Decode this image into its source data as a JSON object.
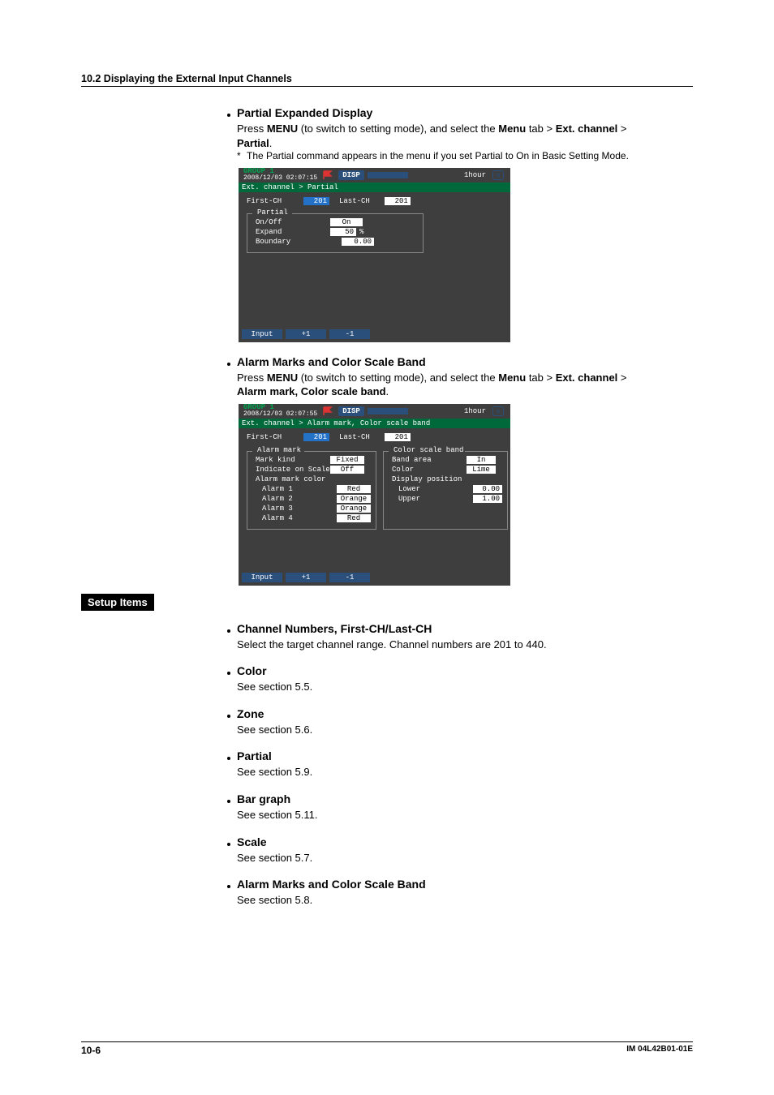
{
  "header": {
    "section": "10.2  Displaying the External Input Channels"
  },
  "partial_section": {
    "title": "Partial Expanded Display",
    "line1_pre": "Press ",
    "menu": "MENU",
    "line1_mid": " (to switch to setting mode), and select the ",
    "menu_tab": "Menu",
    "line1_mid2": " tab > ",
    "ext_channel": "Ext. channel",
    "line1_end": " >",
    "partial_bold": "Partial",
    "period": ".",
    "note": "The Partial command appears in the menu if you set Partial to On in Basic Setting Mode."
  },
  "screenshot1": {
    "group": "GROUP 1",
    "ts": "2008/12/03 02:07:15",
    "disp": "DISP",
    "time": "1hour",
    "breadcrumb": "Ext. channel > Partial",
    "first_ch": "First-CH",
    "first_ch_val": "201",
    "last_ch": "Last-CH",
    "last_ch_val": "201",
    "fs_title": "Partial",
    "row1_lbl": "On/Off",
    "row1_val": "On",
    "row2_lbl": "Expand",
    "row2_val": "50",
    "row2_unit": "%",
    "row3_lbl": "Boundary",
    "row3_val": "0.00",
    "btn_input": "Input",
    "btn_plus": "+1",
    "btn_minus": "-1"
  },
  "alarm_section": {
    "title": "Alarm Marks and Color Scale Band",
    "line1_pre": "Press ",
    "menu": "MENU",
    "line1_mid": " (to switch to setting mode), and select the ",
    "menu_tab": "Menu",
    "line1_mid2": " tab > ",
    "ext_channel": "Ext. channel",
    "line1_end": " >",
    "line2_bold": "Alarm mark, Color scale band",
    "period": "."
  },
  "screenshot2": {
    "group": "GROUP 1",
    "ts": "2008/12/03 02:07:55",
    "disp": "DISP",
    "time": "1hour",
    "breadcrumb": "Ext. channel > Alarm mark, Color scale band",
    "first_ch": "First-CH",
    "first_ch_val": "201",
    "last_ch": "Last-CH",
    "last_ch_val": "201",
    "fs1_title": "Alarm mark",
    "fs1": {
      "r1_lbl": "Mark kind",
      "r1_val": "Fixed",
      "r2_lbl": "Indicate on Scale",
      "r2_val": "Off",
      "r3_lbl": "Alarm mark color",
      "r4_lbl": "Alarm 1",
      "r4_val": "Red",
      "r5_lbl": "Alarm 2",
      "r5_val": "Orange",
      "r6_lbl": "Alarm 3",
      "r6_val": "Orange",
      "r7_lbl": "Alarm 4",
      "r7_val": "Red"
    },
    "fs2_title": "Color scale band",
    "fs2": {
      "r1_lbl": "Band area",
      "r1_val": "In",
      "r2_lbl": "Color",
      "r2_val": "Lime",
      "r3_lbl": "Display position",
      "r4_lbl": "Lower",
      "r4_val": "0.00",
      "r5_lbl": "Upper",
      "r5_val": "1.00"
    },
    "btn_input": "Input",
    "btn_plus": "+1",
    "btn_minus": "-1"
  },
  "setup_items_label": "Setup Items",
  "setup": {
    "s1_title": "Channel Numbers, First-CH/Last-CH",
    "s1_body": "Select the target channel range. Channel numbers are 201 to 440.",
    "s2_title": "Color",
    "s2_body": "See section 5.5.",
    "s3_title": "Zone",
    "s3_body": "See section 5.6.",
    "s4_title": "Partial",
    "s4_body": "See section 5.9.",
    "s5_title": "Bar graph",
    "s5_body": "See section 5.11.",
    "s6_title": "Scale",
    "s6_body": "See section 5.7.",
    "s7_title": "Alarm Marks and Color Scale Band",
    "s7_body": "See section 5.8."
  },
  "footer": {
    "page": "10-6",
    "doc": "IM 04L42B01-01E"
  }
}
